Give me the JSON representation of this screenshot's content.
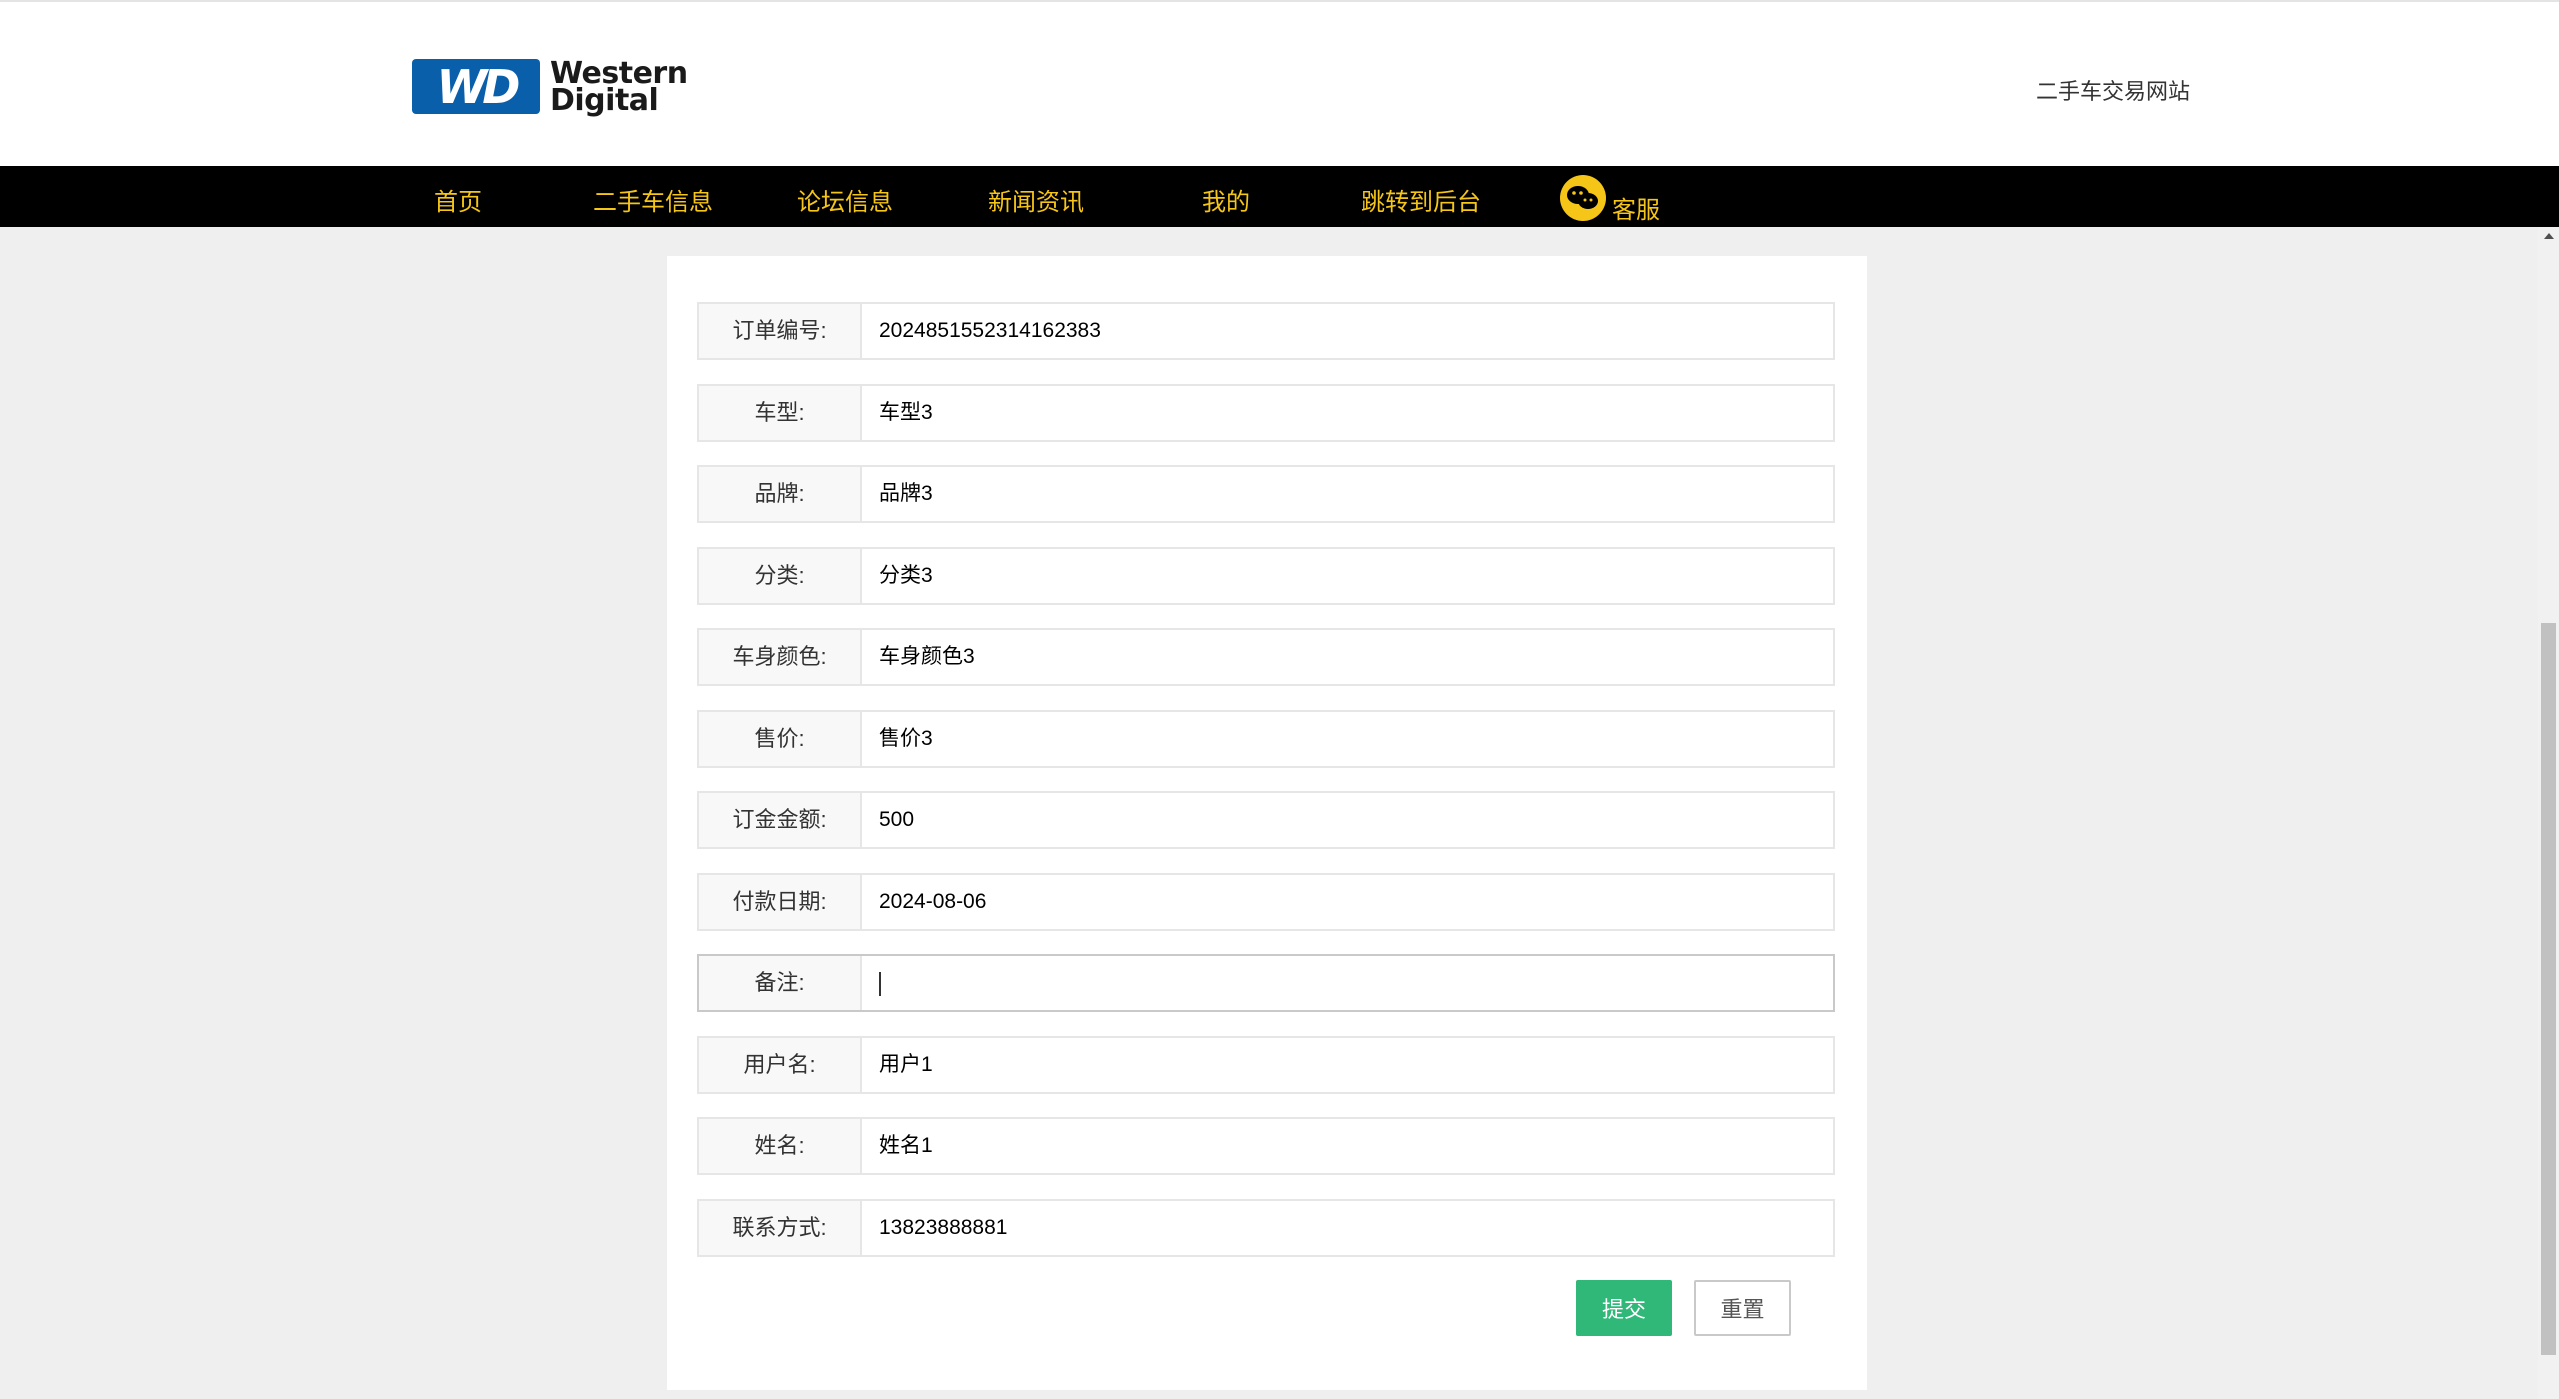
{
  "header": {
    "logo_mark": "WD",
    "logo_text_line1": "Western",
    "logo_text_line2": "Digital",
    "site_name": "二手车交易网站"
  },
  "nav": {
    "items": [
      {
        "label": "首页"
      },
      {
        "label": "二手车信息"
      },
      {
        "label": "论坛信息"
      },
      {
        "label": "新闻资讯"
      },
      {
        "label": "我的"
      },
      {
        "label": "跳转到后台"
      },
      {
        "label": "客服",
        "icon": "wechat-icon"
      }
    ]
  },
  "form": {
    "fields": [
      {
        "label": "订单编号:",
        "value": "2024851552314162383"
      },
      {
        "label": "车型:",
        "value": "车型3"
      },
      {
        "label": "品牌:",
        "value": "品牌3"
      },
      {
        "label": "分类:",
        "value": "分类3"
      },
      {
        "label": "车身颜色:",
        "value": "车身颜色3"
      },
      {
        "label": "售价:",
        "value": "售价3"
      },
      {
        "label": "订金金额:",
        "value": "500"
      },
      {
        "label": "付款日期:",
        "value": "2024-08-06"
      },
      {
        "label": "备注:",
        "value": ""
      },
      {
        "label": "用户名:",
        "value": "用户1"
      },
      {
        "label": "姓名:",
        "value": "姓名1"
      },
      {
        "label": "联系方式:",
        "value": "13823888881"
      }
    ],
    "submit_label": "提交",
    "reset_label": "重置"
  },
  "colors": {
    "nav_background": "#000000",
    "nav_text": "#f5c518",
    "submit_button": "#2fb878",
    "logo_blue": "#0a5fab"
  }
}
